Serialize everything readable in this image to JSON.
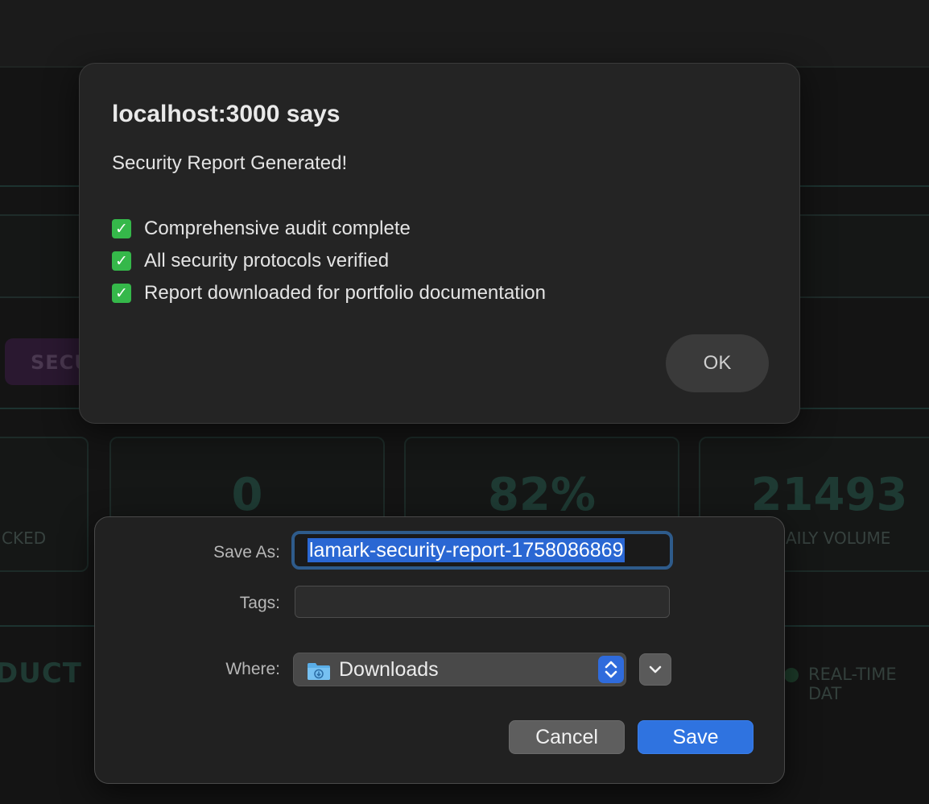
{
  "background": {
    "badge_text": "SECU",
    "stats": [
      {
        "value": "",
        "label": "CKED"
      },
      {
        "value": "0",
        "label": ""
      },
      {
        "value": "82%",
        "label": ""
      },
      {
        "value": "21493",
        "label": "AILY VOLUME"
      }
    ],
    "section_heading": "DUCT P",
    "realtime_label": "REAL-TIME DAT"
  },
  "alert": {
    "title": "localhost:3000 says",
    "message": "Security Report Generated!",
    "lines": [
      "Comprehensive audit complete",
      "All security protocols verified",
      "Report downloaded for portfolio documentation"
    ],
    "check_icon": "check-mark-emoji",
    "ok_label": "OK"
  },
  "save_dialog": {
    "save_as_label": "Save As:",
    "save_as_value": "lamark-security-report-1758086869",
    "tags_label": "Tags:",
    "tags_value": "",
    "where_label": "Where:",
    "where_value": "Downloads",
    "folder_icon": "downloads-folder-icon",
    "cancel_label": "Cancel",
    "save_label": "Save",
    "accent_color": "#2f73e0"
  }
}
